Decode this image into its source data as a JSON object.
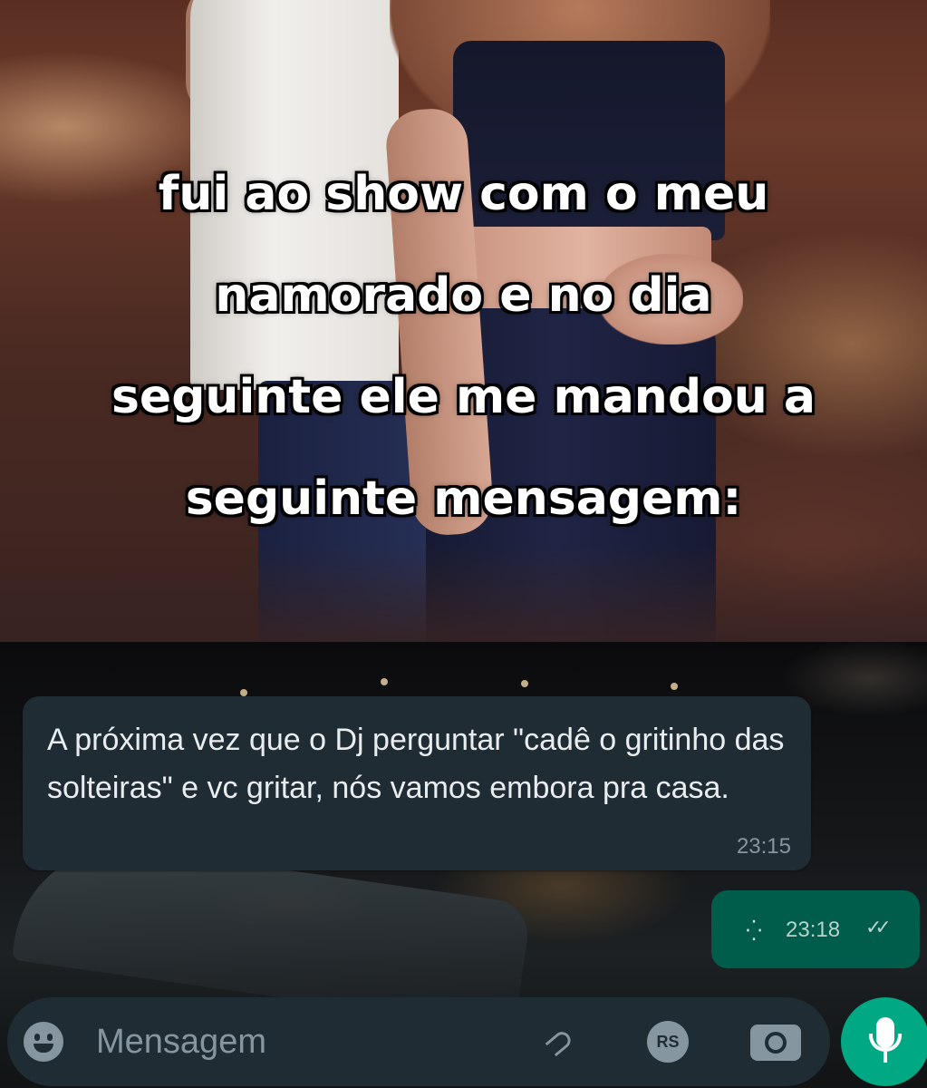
{
  "caption": {
    "lines": [
      "fui ao show com o meu",
      "namorado e no dia",
      "seguinte ele me mandou a",
      "seguinte mensagem:"
    ]
  },
  "chat": {
    "incoming_message": {
      "text": "A próxima vez que o Dj perguntar \"cadê o gritinho das solteiras\" e vc gritar, nós vamos embora pra casa.",
      "time": "23:15"
    },
    "outgoing_message": {
      "content_icon": "sticker-icon",
      "time": "23:18",
      "status_icon": "double-check-icon"
    },
    "input_bar": {
      "placeholder": "Mensagem",
      "icons": [
        "emoji-icon",
        "paperclip-icon",
        "rs-payment-icon",
        "camera-icon",
        "microphone-icon"
      ],
      "rs_label": "RS"
    }
  },
  "colors": {
    "incoming_bubble": "#1f2c34",
    "outgoing_bubble": "#005c4b",
    "mic_button": "#00a884",
    "secondary_text": "#8696a0"
  }
}
